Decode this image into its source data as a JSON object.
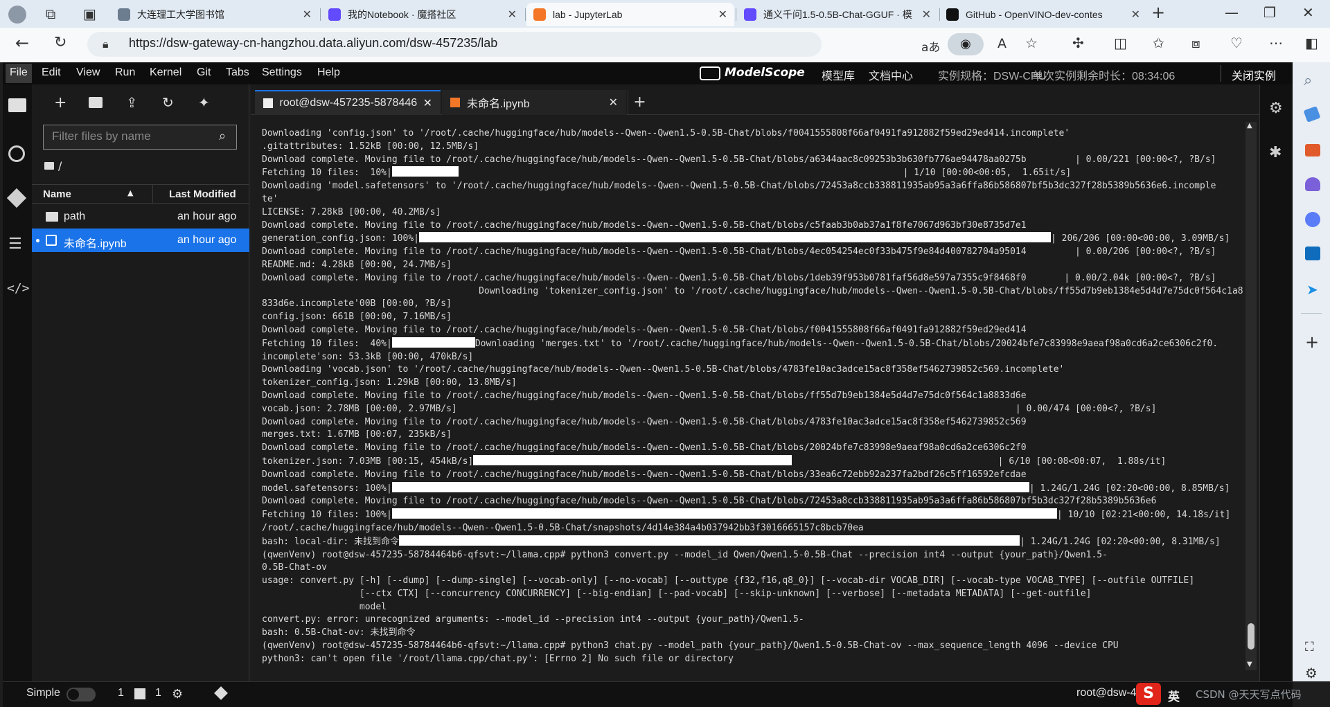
{
  "browser": {
    "tabs": [
      {
        "title": "大连理工大学图书馆",
        "color": "#6c7d8f"
      },
      {
        "title": "我的Notebook · 魔搭社区",
        "color": "#624aff"
      },
      {
        "title": "lab - JupyterLab",
        "color": "#f37726"
      },
      {
        "title": "通义千问1.5-0.5B-Chat-GGUF · 模",
        "color": "#624aff"
      },
      {
        "title": "GitHub - OpenVINO-dev-contes",
        "color": "#111111"
      }
    ],
    "url": "https://dsw-gateway-cn-hangzhou.data.aliyun.com/dsw-457235/lab",
    "reader_label": "aあ",
    "aloud_label": "A"
  },
  "jupyter": {
    "menu": [
      "File",
      "Edit",
      "View",
      "Run",
      "Kernel",
      "Git",
      "Tabs",
      "Settings",
      "Help"
    ],
    "brand": "ModelScope",
    "links": [
      "模型库",
      "文档中心"
    ],
    "instance_spec": "实例规格：DSW-CPU",
    "remaining_time": "单次实例剩余时长：08:34:06",
    "close_instance": "关闭实例",
    "filter_placeholder": "Filter files by name",
    "breadcrumb": "/",
    "columns": {
      "name": "Name",
      "modified": "Last Modified"
    },
    "files": [
      {
        "name": "path",
        "modified": "an hour ago"
      },
      {
        "name": "未命名.ipynb",
        "modified": "an hour ago"
      }
    ],
    "tabs": [
      {
        "label": "root@dsw-457235-5878446"
      },
      {
        "label": "未命名.ipynb"
      }
    ],
    "status": {
      "mode": "Simple",
      "count1": "1",
      "count2": "1",
      "right": "root@dsw-4",
      "ime": "英",
      "watermark": "CSDN @天天写点代码"
    }
  },
  "terminal": {
    "lines": [
      {
        "t": "Downloading 'config.json' to '/root/.cache/huggingface/hub/models--Qwen--Qwen1.5-0.5B-Chat/blobs/f0041555808f66af0491fa912882f59ed29ed414.incomplete'"
      },
      {
        "t": ".gitattributes: 1.52kB [00:00, 12.5MB/s]"
      },
      {
        "t": "Download complete. Moving file to /root/.cache/huggingface/hub/models--Qwen--Qwen1.5-0.5B-Chat/blobs/a6344aac8c09253b3b630fb776ae94478aa0275b         | 0.00/221 [00:00<?, ?B/s]"
      },
      {
        "t": "Fetching 10 files:  10%|",
        "bar": 96,
        "t2": "                                                                                  | 1/10 [00:00<00:05,  1.65it/s]"
      },
      {
        "t": "Downloading 'model.safetensors' to '/root/.cache/huggingface/hub/models--Qwen--Qwen1.5-0.5B-Chat/blobs/72453a8ccb338811935ab95a3a6ffa86b586807bf5b3dc327f28b5389b5636e6.incomple"
      },
      {
        "t": "te'"
      },
      {
        "t": "LICENSE: 7.28kB [00:00, 40.2MB/s]"
      },
      {
        "t": "Download complete. Moving file to /root/.cache/huggingface/hub/models--Qwen--Qwen1.5-0.5B-Chat/blobs/c5faab3b0ab37a1f8fe7067d963bf30e8735d7e1"
      },
      {
        "t": "generation_config.json: 100%|",
        "bar": 912,
        "t2": "| 206/206 [00:00<00:00, 3.09MB/s]"
      },
      {
        "t": "Download complete. Moving file to /root/.cache/huggingface/hub/models--Qwen--Qwen1.5-0.5B-Chat/blobs/4ec054254ec0f33b475f9e84d400782704a95014         | 0.00/206 [00:00<?, ?B/s]"
      },
      {
        "t": "README.md: 4.28kB [00:00, 24.7MB/s]"
      },
      {
        "t": "Download complete. Moving file to /root/.cache/huggingface/hub/models--Qwen--Qwen1.5-0.5B-Chat/blobs/1deb39f953b0781faf56d8e597a7355c9f8468f0       | 0.00/2.04k [00:00<?, ?B/s]"
      },
      {
        "t": "                                        Downloading 'tokenizer_config.json' to '/root/.cache/huggingface/hub/models--Qwen--Qwen1.5-0.5B-Chat/blobs/ff55d7b9eb1384e5d4d7e75dc0f564c1a8"
      },
      {
        "t": "833d6e.incomplete'00B [00:00, ?B/s]"
      },
      {
        "t": "config.json: 661B [00:00, 7.16MB/s]"
      },
      {
        "t": "Download complete. Moving file to /root/.cache/huggingface/hub/models--Qwen--Qwen1.5-0.5B-Chat/blobs/f0041555808f66af0491fa912882f59ed29ed414"
      },
      {
        "t": "Fetching 10 files:  40%|",
        "bar": 120,
        "t2": "Downloading 'merges.txt' to '/root/.cache/huggingface/hub/models--Qwen--Qwen1.5-0.5B-Chat/blobs/20024bfe7c83998e9aeaf98a0cd6a2ce6306c2f0."
      },
      {
        "t": "incomplete'son: 53.3kB [00:00, 470kB/s]"
      },
      {
        "t": "Downloading 'vocab.json' to '/root/.cache/huggingface/hub/models--Qwen--Qwen1.5-0.5B-Chat/blobs/4783fe10ac3adce15ac8f358ef5462739852c569.incomplete'"
      },
      {
        "t": "tokenizer_config.json: 1.29kB [00:00, 13.8MB/s]"
      },
      {
        "t": "Download complete. Moving file to /root/.cache/huggingface/hub/models--Qwen--Qwen1.5-0.5B-Chat/blobs/ff55d7b9eb1384e5d4d7e75dc0f564c1a8833d6e"
      },
      {
        "t": "vocab.json: 2.78MB [00:00, 2.97MB/s]                                                                                                       | 0.00/474 [00:00<?, ?B/s]"
      },
      {
        "t": "Download complete. Moving file to /root/.cache/huggingface/hub/models--Qwen--Qwen1.5-0.5B-Chat/blobs/4783fe10ac3adce15ac8f358ef5462739852c569"
      },
      {
        "t": "merges.txt: 1.67MB [00:07, 235kB/s]"
      },
      {
        "t": "Download complete. Moving file to /root/.cache/huggingface/hub/models--Qwen--Qwen1.5-0.5B-Chat/blobs/20024bfe7c83998e9aeaf98a0cd6a2ce6306c2f0"
      },
      {
        "t": "tokenizer.json: 7.03MB [00:15, 454kB/s]",
        "bar": 460,
        "t2": "                                      | 6/10 [00:08<00:07,  1.88s/it]"
      },
      {
        "t": "Download complete. Moving file to /root/.cache/huggingface/hub/models--Qwen--Qwen1.5-0.5B-Chat/blobs/33ea6c72ebb92a237fa2bdf26c5ff16592efcdae"
      },
      {
        "t": "model.safetensors: 100%|",
        "bar": 920,
        "t2": "| 1.24G/1.24G [02:20<00:00, 8.85MB/s]"
      },
      {
        "t": "Download complete. Moving file to /root/.cache/huggingface/hub/models--Qwen--Qwen1.5-0.5B-Chat/blobs/72453a8ccb338811935ab95a3a6ffa86b586807bf5b3dc327f28b5389b5636e6"
      },
      {
        "t": "Fetching 10 files: 100%|",
        "bar": 960,
        "t2": "| 10/10 [02:21<00:00, 14.18s/it]"
      },
      {
        "t": "/root/.cache/huggingface/hub/models--Qwen--Qwen1.5-0.5B-Chat/snapshots/4d14e384a4b037942bb3f3016665157c8bcb70ea"
      },
      {
        "t": "bash: local-dir: 未找到命令",
        "bar": 896,
        "t2": "| 1.24G/1.24G [02:20<00:00, 8.31MB/s]"
      },
      {
        "t": "(qwenVenv) root@dsw-457235-58784464b6-qfsvt:~/llama.cpp# python3 convert.py --model_id Qwen/Qwen1.5-0.5B-Chat --precision int4 --output {your_path}/Qwen1.5-"
      },
      {
        "t": "0.5B-Chat-ov"
      },
      {
        "t": "usage: convert.py [-h] [--dump] [--dump-single] [--vocab-only] [--no-vocab] [--outtype {f32,f16,q8_0}] [--vocab-dir VOCAB_DIR] [--vocab-type VOCAB_TYPE] [--outfile OUTFILE]"
      },
      {
        "t": "                  [--ctx CTX] [--concurrency CONCURRENCY] [--big-endian] [--pad-vocab] [--skip-unknown] [--verbose] [--metadata METADATA] [--get-outfile]"
      },
      {
        "t": "                  model"
      },
      {
        "t": "convert.py: error: unrecognized arguments: --model_id --precision int4 --output {your_path}/Qwen1.5-"
      },
      {
        "t": "bash: 0.5B-Chat-ov: 未找到命令"
      },
      {
        "t": "(qwenVenv) root@dsw-457235-58784464b6-qfsvt:~/llama.cpp# python3 chat.py --model_path {your_path}/Qwen1.5-0.5B-Chat-ov --max_sequence_length 4096 --device CPU"
      },
      {
        "t": "python3: can't open file '/root/llama.cpp/chat.py': [Errno 2] No such file or directory"
      }
    ]
  },
  "icons": {
    "folder": "folder-icon",
    "running": "stop-circle-icon",
    "git": "git-icon",
    "toc": "list-icon",
    "code": "code-icon",
    "gear": "gear-icon",
    "bug": "bug-icon"
  }
}
